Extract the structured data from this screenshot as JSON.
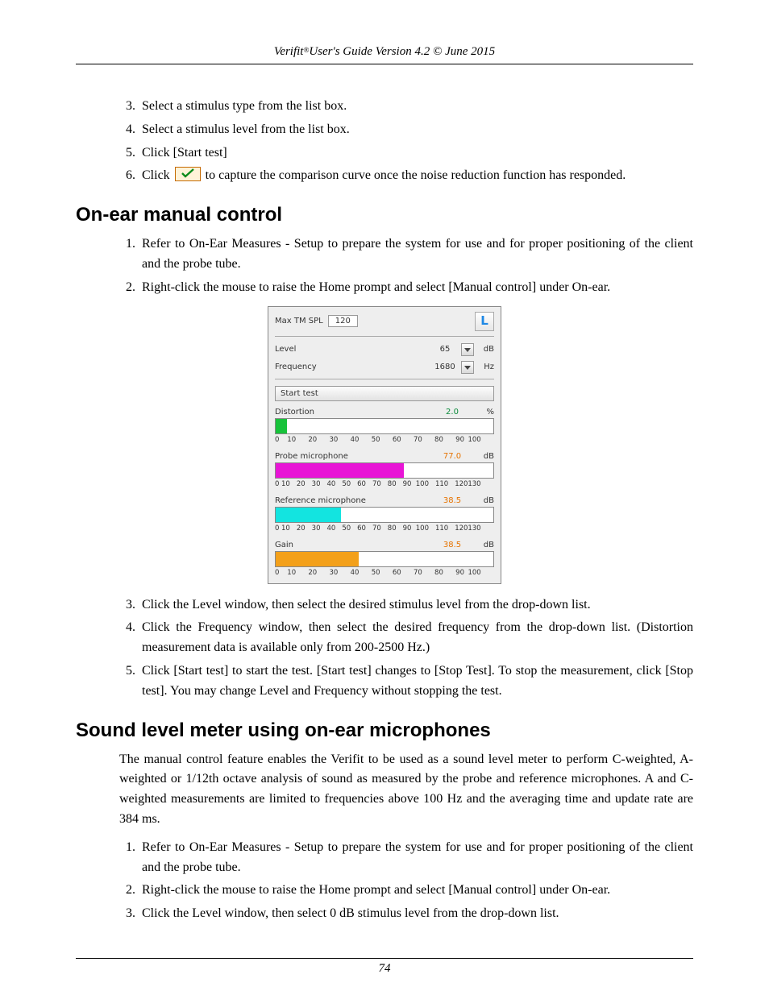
{
  "header": "Verifit®User's Guide Version 4.2 © June 2015",
  "page_number": "74",
  "top_list": {
    "start": 3,
    "items": [
      "Select a stimulus type from the list box.",
      "Select a stimulus level from the list box.",
      "Click [Start test]",
      "Click {CHECK} to capture the comparison curve once the noise reduction function has responded."
    ]
  },
  "section1": {
    "heading": "On-ear manual control",
    "list1": {
      "start": 1,
      "items": [
        "Refer to On-Ear Measures - Setup to prepare the system for use and for proper positioning of the client and the probe tube.",
        "Right-click the mouse to raise the Home prompt and select [Manual control] under On-ear."
      ]
    },
    "panel": {
      "max_tm_spl_label": "Max TM SPL",
      "max_tm_spl_value": "120",
      "badge": "L",
      "level_label": "Level",
      "level_value": "65",
      "level_unit": "dB",
      "freq_label": "Frequency",
      "freq_value": "1680",
      "freq_unit": "Hz",
      "start_test": "Start test",
      "distortion": {
        "label": "Distortion",
        "value": "2.0",
        "unit": "%",
        "ticks": [
          "0",
          "10",
          "20",
          "30",
          "40",
          "50",
          "60",
          "70",
          "80",
          "90",
          "100"
        ],
        "fill_pct": 5
      },
      "probe": {
        "label": "Probe microphone",
        "value": "77.0",
        "unit": "dB",
        "ticks": [
          "0",
          "10",
          "20",
          "30",
          "40",
          "50",
          "60",
          "70",
          "80",
          "90",
          "100",
          "110",
          "120",
          "130"
        ],
        "fill_pct": 59
      },
      "reference": {
        "label": "Reference microphone",
        "value": "38.5",
        "unit": "dB",
        "ticks": [
          "0",
          "10",
          "20",
          "30",
          "40",
          "50",
          "60",
          "70",
          "80",
          "90",
          "100",
          "110",
          "120",
          "130"
        ],
        "fill_pct": 30
      },
      "gain": {
        "label": "Gain",
        "value": "38.5",
        "unit": "dB",
        "ticks": [
          "0",
          "10",
          "20",
          "30",
          "40",
          "50",
          "60",
          "70",
          "80",
          "90",
          "100"
        ],
        "fill_pct": 38
      }
    },
    "list2": {
      "start": 3,
      "items": [
        "Click the Level window, then select the desired stimulus level from the drop-down list.",
        "Click the Frequency window, then select the desired frequency from the drop-down list. (Distortion measurement data is available only from 200-2500 Hz.)",
        "Click [Start test] to start the test. [Start test] changes to [Stop Test]. To stop the measurement, click [Stop test]. You may change Level and Frequency without stopping the test."
      ]
    }
  },
  "section2": {
    "heading": "Sound level meter using on-ear microphones",
    "paragraph": "The manual control feature enables the Verifit to be used as a sound level meter to perform C-weighted, A-weighted or 1/12th octave analysis of sound as measured by the probe and reference microphones. A and C-weighted measurements are limited to frequencies above 100 Hz and the averaging time and update rate are 384 ms.",
    "list": {
      "start": 1,
      "items": [
        "Refer to On-Ear Measures - Setup to prepare the system for use and for proper positioning of the client and the probe tube.",
        "Right-click the mouse to raise the Home prompt and select [Manual control] under On-ear.",
        "Click the Level window, then select 0 dB stimulus level from the drop-down list."
      ]
    }
  }
}
